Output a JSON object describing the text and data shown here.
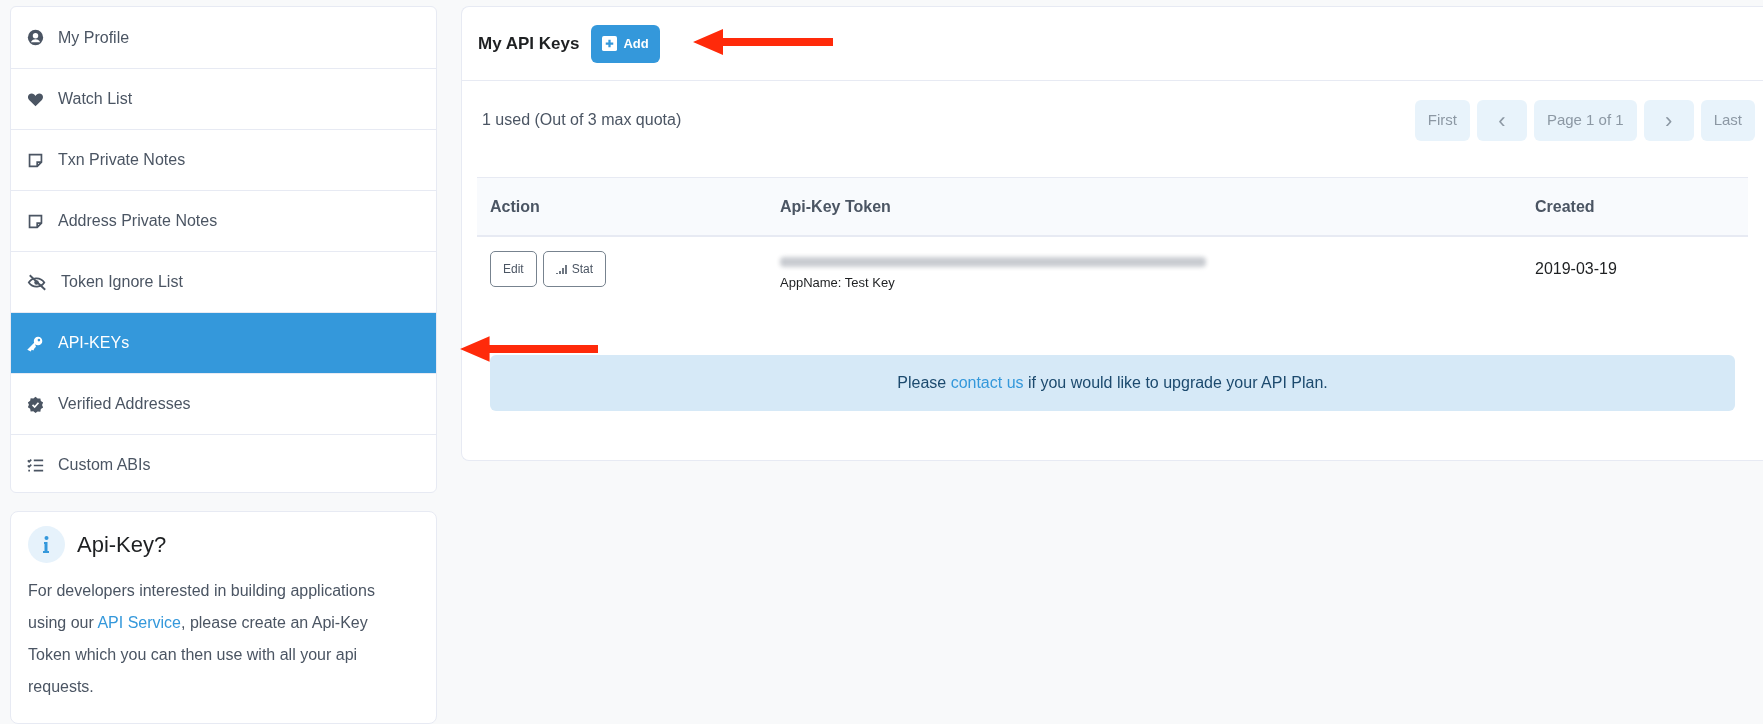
{
  "sidebar": {
    "items": [
      {
        "label": "My Profile",
        "kind": "user",
        "selected": false
      },
      {
        "label": "Watch List",
        "kind": "heart",
        "selected": false
      },
      {
        "label": "Txn Private Notes",
        "kind": "note",
        "selected": false
      },
      {
        "label": "Address Private Notes",
        "kind": "note",
        "selected": false
      },
      {
        "label": "Token Ignore List",
        "kind": "eye-off",
        "selected": false
      },
      {
        "label": "API-KEYs",
        "kind": "key",
        "selected": true
      },
      {
        "label": "Verified Addresses",
        "kind": "badge",
        "selected": false
      },
      {
        "label": "Custom ABIs",
        "kind": "list",
        "selected": false
      }
    ]
  },
  "info_card": {
    "title": "Api-Key?",
    "text_before": "For developers interested in building applications using our",
    "link": "API Service",
    "text_after": ", please create an Api-Key Token which you can then use with all your api requests."
  },
  "main": {
    "title": "My API Keys",
    "add_button": "Add",
    "quota": "1 used (Out of 3 max quota)",
    "pagination": [
      {
        "label": "First",
        "kind": "text"
      },
      {
        "label": "‹",
        "kind": "arrow"
      },
      {
        "label": "Page 1 of 1",
        "kind": "text"
      },
      {
        "label": "›",
        "kind": "arrow"
      },
      {
        "label": "Last",
        "kind": "text"
      }
    ],
    "table": {
      "columns": [
        "Action",
        "Api-Key Token",
        "Created"
      ],
      "rows": [
        {
          "actions": [
            {
              "label": "Edit",
              "kind": "edit"
            },
            {
              "label": "Stat",
              "kind": "stat"
            }
          ],
          "app_name": "AppName: Test Key",
          "created": "2019-03-19"
        }
      ]
    },
    "alert": {
      "before": "Please",
      "link": "contact us",
      "after": "if you would like to upgrade your API Plan."
    }
  }
}
